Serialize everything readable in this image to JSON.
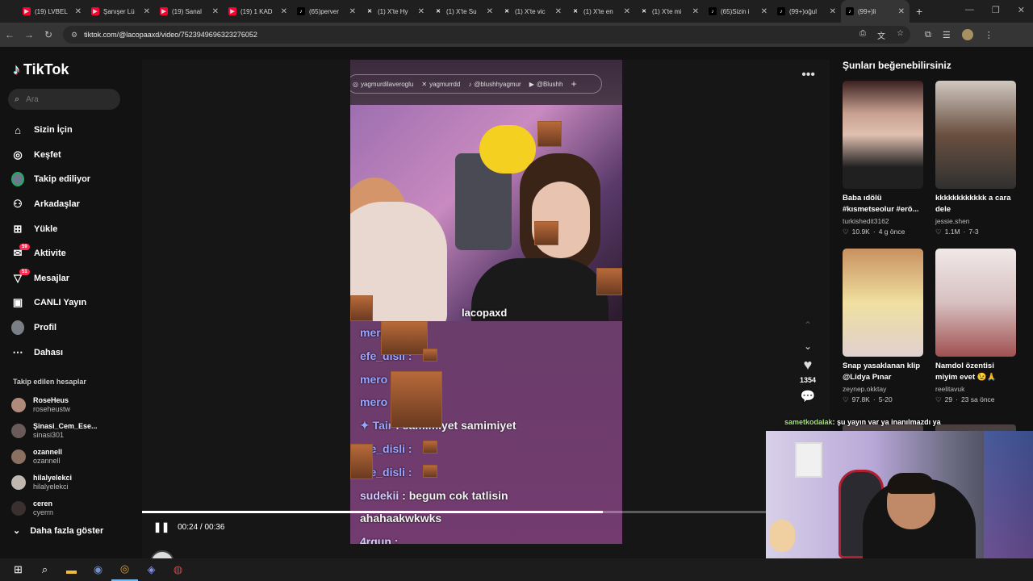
{
  "browser": {
    "tabs": [
      {
        "label": "(19) LVBEL",
        "icon": "youtube-icon"
      },
      {
        "label": "Şanışer Lü",
        "icon": "youtube-icon"
      },
      {
        "label": "(19) Sanal",
        "icon": "youtube-icon"
      },
      {
        "label": "(19) 1 KAD",
        "icon": "youtube-icon"
      },
      {
        "label": "(65)perver",
        "icon": "tiktok-icon"
      },
      {
        "label": "(1) X'te Hy",
        "icon": "x-icon"
      },
      {
        "label": "(1) X'te Su",
        "icon": "x-icon"
      },
      {
        "label": "(1) X'te vic",
        "icon": "x-icon"
      },
      {
        "label": "(1) X'te en",
        "icon": "x-icon"
      },
      {
        "label": "(1) X'te mi",
        "icon": "x-icon"
      },
      {
        "label": "(65)Sizin i",
        "icon": "tiktok-icon"
      },
      {
        "label": "(99+)oğul",
        "icon": "tiktok-icon"
      },
      {
        "label": "(99+)li",
        "icon": "tiktok-icon"
      }
    ],
    "url": "tiktok.com/@lacopaaxd/video/7523949696323276052"
  },
  "sidebar": {
    "logo": "TikTok",
    "search_placeholder": "Ara",
    "nav": [
      {
        "label": "Sizin İçin",
        "icon": "home-icon"
      },
      {
        "label": "Keşfet",
        "icon": "compass-icon"
      },
      {
        "label": "Takip ediliyor",
        "icon": "following-avatar-icon"
      },
      {
        "label": "Arkadaşlar",
        "icon": "friends-icon"
      },
      {
        "label": "Yükle",
        "icon": "upload-icon"
      },
      {
        "label": "Aktivite",
        "icon": "activity-icon",
        "badge": "59"
      },
      {
        "label": "Mesajlar",
        "icon": "messages-icon",
        "badge": "51"
      },
      {
        "label": "CANLI Yayın",
        "icon": "live-icon"
      },
      {
        "label": "Profil",
        "icon": "profile-avatar-icon"
      },
      {
        "label": "Dahası",
        "icon": "more-dots-icon"
      }
    ],
    "following_header": "Takip edilen hesaplar",
    "following": [
      {
        "name": "RoseHeus",
        "handle": "roseheustw",
        "color": "#b08a7a"
      },
      {
        "name": "Şinasi_Cem_Ese...",
        "handle": "sinasi301",
        "color": "#6a5a5a"
      },
      {
        "name": "ozannell",
        "handle": "ozannell",
        "color": "#8a7060"
      },
      {
        "name": "hilalyelekci",
        "handle": "hilalyelekci",
        "color": "#c0b8b0"
      },
      {
        "name": "ceren",
        "handle": "cyerrn",
        "color": "#3a3030"
      }
    ],
    "show_more": "Daha fazla göster"
  },
  "video": {
    "socials": [
      "yagmurdilaveroglu",
      "yagmurrdd",
      "@blushhyagmur",
      "@Blushh"
    ],
    "overlay_username": "lacopaxd",
    "chat": [
      {
        "user": "mero",
        "msg": ""
      },
      {
        "user": "efe_disli :",
        "msg": ""
      },
      {
        "user": "mero",
        "msg": ""
      },
      {
        "user": "mero",
        "msg": ""
      },
      {
        "user": "✦ Tair",
        "msg": ": samimiyet samimiyet"
      },
      {
        "user": "efe_disli :",
        "msg": ""
      },
      {
        "user": "efe_disli :",
        "msg": ""
      },
      {
        "user": "sudekii",
        "msg": ": begum cok tatlisin"
      },
      {
        "user": "",
        "msg": "ahahaakwkwks"
      },
      {
        "user": "4rgun :",
        "msg": ""
      }
    ],
    "time": "00:24 / 00:36",
    "progress": 0.67,
    "likes": "1354",
    "author": "lacopaaxd"
  },
  "recommendations": {
    "title": "Şunları beğenebilirsiniz",
    "items": [
      {
        "title": "Baba ıdölü #kısmetseolur #erö...",
        "user": "turkishedit3162",
        "likes": "10.9K",
        "time": "4 g önce"
      },
      {
        "title": "kkkkkkkkkkkk a cara dele",
        "user": "jessie.shen",
        "likes": "1.1M",
        "time": "7-3"
      },
      {
        "title": "Snap yasaklanan klip @Lidya Pınar",
        "user": "zeynep.okktay",
        "likes": "97.8K",
        "time": "5-20"
      },
      {
        "title": "Namdol özentisi miyim evet 😉🙏",
        "user": "reelitavuk",
        "likes": "29",
        "time": "23 sa önce"
      }
    ]
  },
  "stream_overlay": {
    "chat_user": "sametkodalak",
    "chat_msg": ": şu yayın var ya inanılmazdı ya"
  }
}
